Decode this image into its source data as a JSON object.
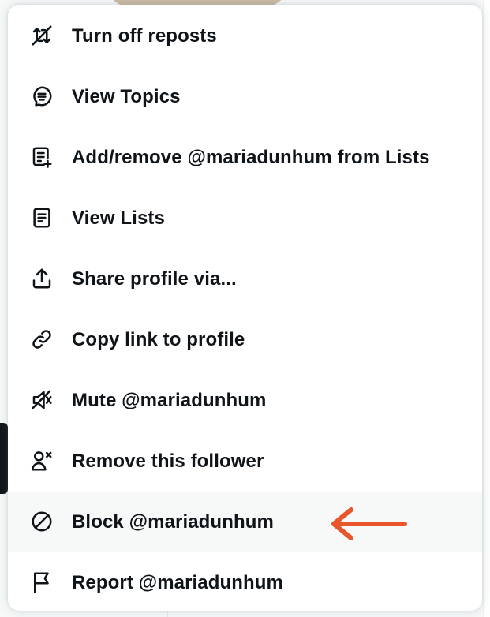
{
  "menu": {
    "items": [
      {
        "label": "Turn off reposts",
        "icon": "repost-off-icon"
      },
      {
        "label": "View Topics",
        "icon": "topics-icon"
      },
      {
        "label": "Add/remove @mariadunhum from Lists",
        "icon": "list-add-icon"
      },
      {
        "label": "View Lists",
        "icon": "lists-icon"
      },
      {
        "label": "Share profile via...",
        "icon": "share-icon"
      },
      {
        "label": "Copy link to profile",
        "icon": "link-icon"
      },
      {
        "label": "Mute @mariadunhum",
        "icon": "mute-icon"
      },
      {
        "label": "Remove this follower",
        "icon": "remove-follower-icon"
      },
      {
        "label": "Block @mariadunhum",
        "icon": "block-icon",
        "highlighted": true
      },
      {
        "label": "Report @mariadunhum",
        "icon": "flag-icon"
      }
    ]
  },
  "annotation": {
    "icon": "arrow-left-icon",
    "color": "#e8562a"
  },
  "colors": {
    "text": "#0f1419",
    "hover": "#f7f9f9"
  }
}
